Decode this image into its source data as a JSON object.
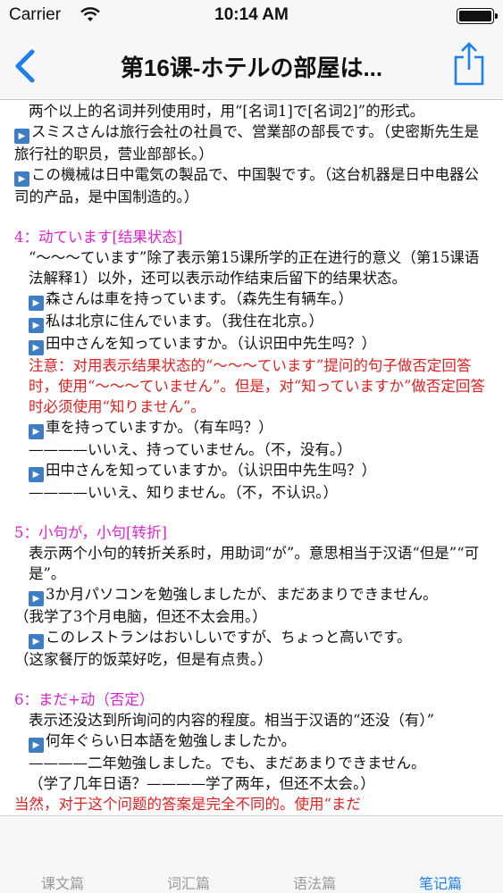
{
  "status": {
    "carrier": "Carrier",
    "time": "10:14 AM"
  },
  "nav": {
    "title": "第16课-ホテルの部屋は..."
  },
  "colors": {
    "accent": "#1a7ff0",
    "heading": "#e020d0",
    "warning": "#e02020"
  },
  "content": {
    "p1": "两个以上的名词并列使用时，用“[名词1]で[名词2]”的形式。",
    "p2": "スミスさんは旅行会社の社員で、営業部の部長です。（史密斯先生是旅行社的职员，营业部部长。）",
    "p3": "この機械は日中電気の製品で、中国製です。（这台机器是日中电器公司的产品，是中国制造的。）",
    "h4": "4：动ています[结果状态]",
    "p4": "“～～～ています”除了表示第15课所学的正在进行的意义（第15课语法解释1）以外，还可以表示动作结束后留下的结果状态。",
    "ex4a": "森さんは車を持っています。（森先生有辆车。）",
    "ex4b": "私は北京に住んでいます。（我住在北京。）",
    "ex4c": "田中さんを知っていますか。（认识田中先生吗？）",
    "note4": "注意：对用表示结果状态的“～～～ています”提问的句子做否定回答时，使用“～～～ていません”。但是，对“知っていますか”做否定回答时必须使用“知りません”。",
    "ex4d": "車を持っていますか。（有车吗？）",
    "ex4e": "————いいえ、持っていません。（不，没有。）",
    "ex4f": "田中さんを知っていますか。（认识田中先生吗？）",
    "ex4g": "————いいえ、知りません。（不，不认识。）",
    "h5": "5：小句が，小句[转折]",
    "p5": "表示两个小句的转折关系时，用助词“が”。意思相当于汉语“但是”“可是”。",
    "ex5a": "3か月パソコンを勉強しましたが、まだあまりできません。",
    "ex5a_tr": "（我学了3个月电脑，但还不太会用。）",
    "ex5b": "このレストランはおいしいですが、ちょっと高いです。",
    "ex5b_tr": "（这家餐厅的饭菜好吃，但是有点贵。）",
    "h6": "6：まだ+动（否定）",
    "p6": "表示还没达到所询问的内容的程度。相当于汉语的“还没（有）”",
    "ex6a": "何年ぐらい日本語を勉強しましたか。",
    "ex6b": "————二年勉強しました。でも、まだあまりできません。",
    "ex6c": "（学了几年日语？————学了两年，但还不太会。）",
    "cut": "当然，对于这个问题的答案是完全不同的。使用“まだ"
  },
  "tabs": [
    "课文篇",
    "词汇篇",
    "语法篇",
    "笔记篇"
  ],
  "active_tab": "笔记篇"
}
